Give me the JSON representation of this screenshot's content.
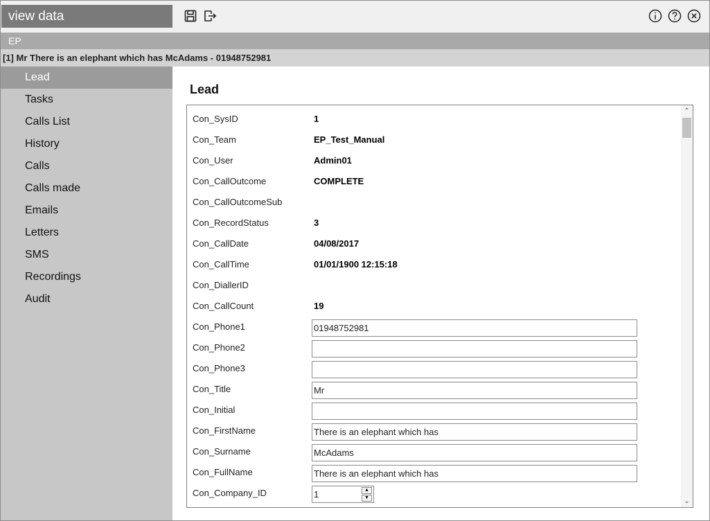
{
  "window": {
    "title": "view data"
  },
  "toolbar": {
    "save_icon": "save-icon",
    "exit_icon": "exit-icon"
  },
  "window_controls": {
    "info_icon": "info-icon",
    "help_icon": "help-icon",
    "close_icon": "close-icon"
  },
  "group": {
    "label": "EP"
  },
  "record": {
    "header": "[1] Mr There is an elephant which has McAdams - 01948752981"
  },
  "sidebar": {
    "items": [
      {
        "label": "Lead",
        "active": true
      },
      {
        "label": "Tasks"
      },
      {
        "label": "Calls List"
      },
      {
        "label": "History"
      },
      {
        "label": "Calls"
      },
      {
        "label": "Calls made"
      },
      {
        "label": "Emails"
      },
      {
        "label": "Letters"
      },
      {
        "label": "SMS"
      },
      {
        "label": "Recordings"
      },
      {
        "label": "Audit"
      }
    ]
  },
  "main": {
    "title": "Lead",
    "fields": [
      {
        "label": "Con_SysID",
        "value": "1",
        "kind": "text"
      },
      {
        "label": "Con_Team",
        "value": "EP_Test_Manual",
        "kind": "text"
      },
      {
        "label": "Con_User",
        "value": "Admin01",
        "kind": "text"
      },
      {
        "label": "Con_CallOutcome",
        "value": "COMPLETE",
        "kind": "text"
      },
      {
        "label": "Con_CallOutcomeSub",
        "value": "",
        "kind": "text"
      },
      {
        "label": "Con_RecordStatus",
        "value": "3",
        "kind": "text"
      },
      {
        "label": "Con_CallDate",
        "value": "04/08/2017",
        "kind": "text"
      },
      {
        "label": "Con_CallTime",
        "value": "01/01/1900 12:15:18",
        "kind": "text"
      },
      {
        "label": "Con_DiallerID",
        "value": "",
        "kind": "text"
      },
      {
        "label": "Con_CallCount",
        "value": "19",
        "kind": "text"
      },
      {
        "label": "Con_Phone1",
        "value": "01948752981",
        "kind": "input"
      },
      {
        "label": "Con_Phone2",
        "value": "",
        "kind": "input"
      },
      {
        "label": "Con_Phone3",
        "value": "",
        "kind": "input"
      },
      {
        "label": "Con_Title",
        "value": "Mr",
        "kind": "input"
      },
      {
        "label": "Con_Initial",
        "value": "",
        "kind": "input"
      },
      {
        "label": "Con_FirstName",
        "value": "There is an elephant which has",
        "kind": "input"
      },
      {
        "label": "Con_Surname",
        "value": "McAdams",
        "kind": "input"
      },
      {
        "label": "Con_FullName",
        "value": "There is an elephant which has",
        "kind": "input"
      },
      {
        "label": "Con_Company_ID",
        "value": "1",
        "kind": "spinner"
      }
    ]
  },
  "colors": {
    "sidebar_bg": "#c7c7c7",
    "sidebar_active": "#9b9b9b",
    "title_box": "#7a7a7a",
    "group_bar": "#a9a9a9",
    "record_bar": "#d3d3d3"
  }
}
